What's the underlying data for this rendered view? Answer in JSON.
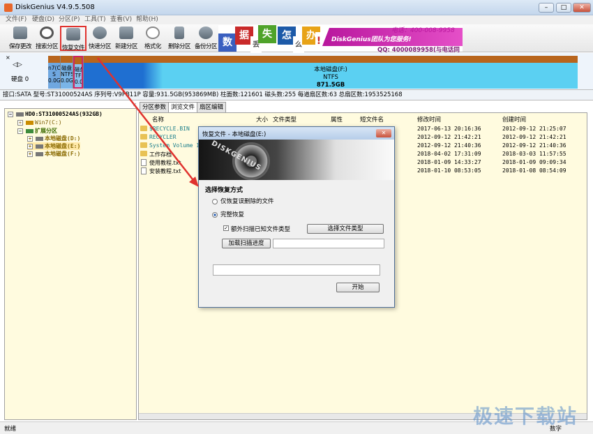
{
  "window": {
    "title": "DiskGenius V4.9.5.508",
    "min": "–",
    "max": "□",
    "close": "✕"
  },
  "menu": [
    "文件(F)",
    "硬盘(D)",
    "分区(P)",
    "工具(T)",
    "查看(V)",
    "帮助(H)"
  ],
  "toolbar": [
    "保存更改",
    "搜索分区",
    "恢复文件",
    "快速分区",
    "新建分区",
    "格式化",
    "删除分区",
    "备份分区"
  ],
  "banner": {
    "chars": [
      "数",
      "据",
      "丢",
      "失",
      "怎",
      "么",
      "办",
      "!"
    ],
    "team": "DiskGenius团队为您服务!",
    "hotline": "电话：400-008-9958",
    "qq": "QQ: 4000089958(与电话同号)"
  },
  "disk": {
    "nav": "◁▷",
    "label": "硬盘 0",
    "segments": [
      "n7(C:)\nS\n0.0G",
      "磁盘\nNTFS\n0.0G",
      "磁盘\nTF\n0.0G"
    ],
    "main_name": "本地磁盘(F:)",
    "main_fs": "NTFS",
    "main_size": "871.5GB"
  },
  "info": "接口:SATA   型号:ST31000524AS   序列号:V9PB11P   容量:931.5GB(953869MB)   柱面数:121601   磁头数:255   每道扇区数:63   总扇区数:1953525168",
  "tree": [
    {
      "toggle": "−",
      "text": "HD0:ST31000524AS(932GB)"
    },
    {
      "toggle": "+",
      "text": "Win7(C:)"
    },
    {
      "toggle": "−",
      "text": "扩展分区"
    },
    {
      "toggle": "+",
      "text": "本地磁盘(D:)"
    },
    {
      "toggle": "+",
      "text": "本地磁盘(E:)"
    },
    {
      "toggle": "+",
      "text": "本地磁盘(F:)"
    }
  ],
  "tabs": [
    "分区参数",
    "浏览文件",
    "扇区编辑"
  ],
  "headers": [
    "名称",
    "大小",
    "文件类型",
    "属性",
    "短文件名",
    "修改时间",
    "创建时间"
  ],
  "files": [
    {
      "name": "$RECYCLE.BIN",
      "modified": "2017-06-13 20:16:36",
      "created": "2012-09-12 21:25:07"
    },
    {
      "name": "RECYCLER",
      "modified": "2012-09-12 21:42:21",
      "created": "2012-09-12 21:42:21"
    },
    {
      "name": "System Volume Info",
      "modified": "2012-09-12 21:40:36",
      "created": "2012-09-12 21:40:36"
    },
    {
      "name": "工作存档",
      "modified": "2018-04-02 17:31:09",
      "created": "2018-03-03 11:57:55"
    },
    {
      "name": "使用教程.txt",
      "modified": "2018-01-09 14:33:27",
      "created": "2018-01-09 09:09:34"
    },
    {
      "name": "安装教程.txt",
      "modified": "2018-01-10 08:53:05",
      "created": "2018-01-08 08:54:09"
    }
  ],
  "dialog": {
    "title": "恢复文件 - 本地磁盘(E:)",
    "close": "✕",
    "brand": "DISKGENIUS",
    "section": "选择恢复方式",
    "opt1": "仅恢复误删除的文件",
    "opt2": "完整恢复",
    "check": "额外扫描已知文件类型",
    "check_mark": "✓",
    "select_btn": "选择文件类型",
    "load_btn": "加载扫描进度",
    "start_btn": "开始"
  },
  "status": {
    "left": "就绪",
    "right": "数字"
  },
  "watermark": "极速下载站",
  "colors": {
    "accent": "#e0322e",
    "partition_main": "#1f6fd1",
    "tree_bg": "#fffbdf",
    "banner": "#b8179d"
  }
}
